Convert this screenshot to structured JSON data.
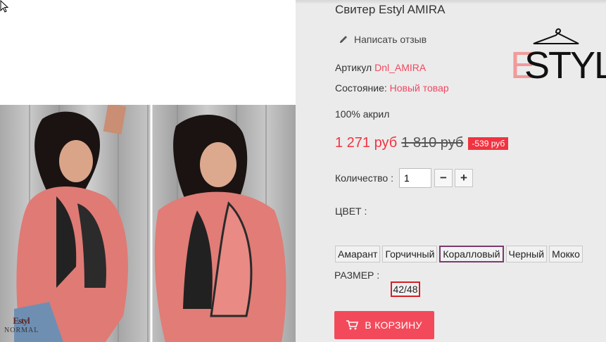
{
  "product": {
    "title": "Свитер Estyl AMIRA",
    "review_label": "Написать отзыв",
    "sku_label": "Артикул",
    "sku_value": "Dnl_AMIRA",
    "condition_label": "Состояние:",
    "condition_value": "Новый товар",
    "composition": "100% акрил",
    "price_new": "1 271 руб",
    "price_old": "1 810 руб",
    "discount": "-539 руб",
    "quantity_label": "Количество :",
    "quantity_value": "1",
    "minus_label": "−",
    "plus_label": "+",
    "color_label": "ЦВЕТ :",
    "colors": [
      "Амарант",
      "Горчичный",
      "Коралловый",
      "Черный",
      "Мокко"
    ],
    "selected_color": "Коралловый",
    "size_label": "РАЗМЕР :",
    "sizes": [
      "42/48"
    ],
    "selected_size": "42/48",
    "cart_label": "В КОРЗИНУ"
  },
  "brand": {
    "logo_letter_e": "E",
    "logo_text": "STYL"
  },
  "image_watermark": {
    "top": "Estyl",
    "bottom": "NORMAL"
  },
  "colors": {
    "accent": "#f34a5b",
    "price": "#f13340",
    "link": "#f0485f",
    "selected_border": "#7b3a6f",
    "size_border": "#d61f25"
  },
  "icons": {
    "review": "pencil-icon",
    "cart": "cart-icon",
    "logo": "hanger-icon"
  }
}
